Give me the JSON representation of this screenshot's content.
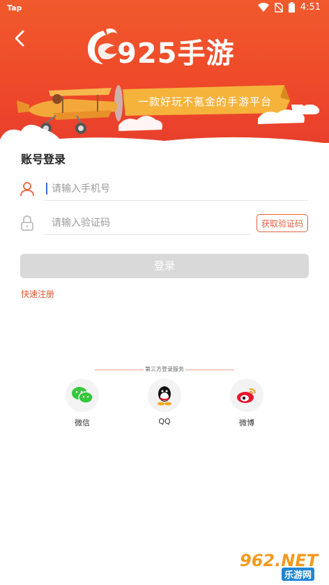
{
  "status_bar": {
    "carrier": "Tap",
    "time": "4:51"
  },
  "header": {
    "logo_text": "925手游",
    "banner_text": "一款好玩不氪金的手游平台"
  },
  "form": {
    "title": "账号登录",
    "phone_placeholder": "请输入手机号",
    "phone_value": "",
    "code_placeholder": "请输入验证码",
    "code_value": "",
    "get_code_label": "获取验证码",
    "login_label": "登录",
    "register_label": "快速注册"
  },
  "third_party": {
    "title": "第三方登录服务",
    "items": [
      {
        "label": "微信",
        "icon": "wechat-icon"
      },
      {
        "label": "QQ",
        "icon": "qq-icon"
      },
      {
        "label": "微博",
        "icon": "weibo-icon"
      }
    ]
  },
  "watermark": {
    "text": "962.NET",
    "sub": "乐游网"
  },
  "colors": {
    "header": "#ef4a2a",
    "accent": "#e3623c",
    "button_disabled": "#d9d9d9",
    "wechat": "#35c83b",
    "weibo": "#e6162d"
  }
}
